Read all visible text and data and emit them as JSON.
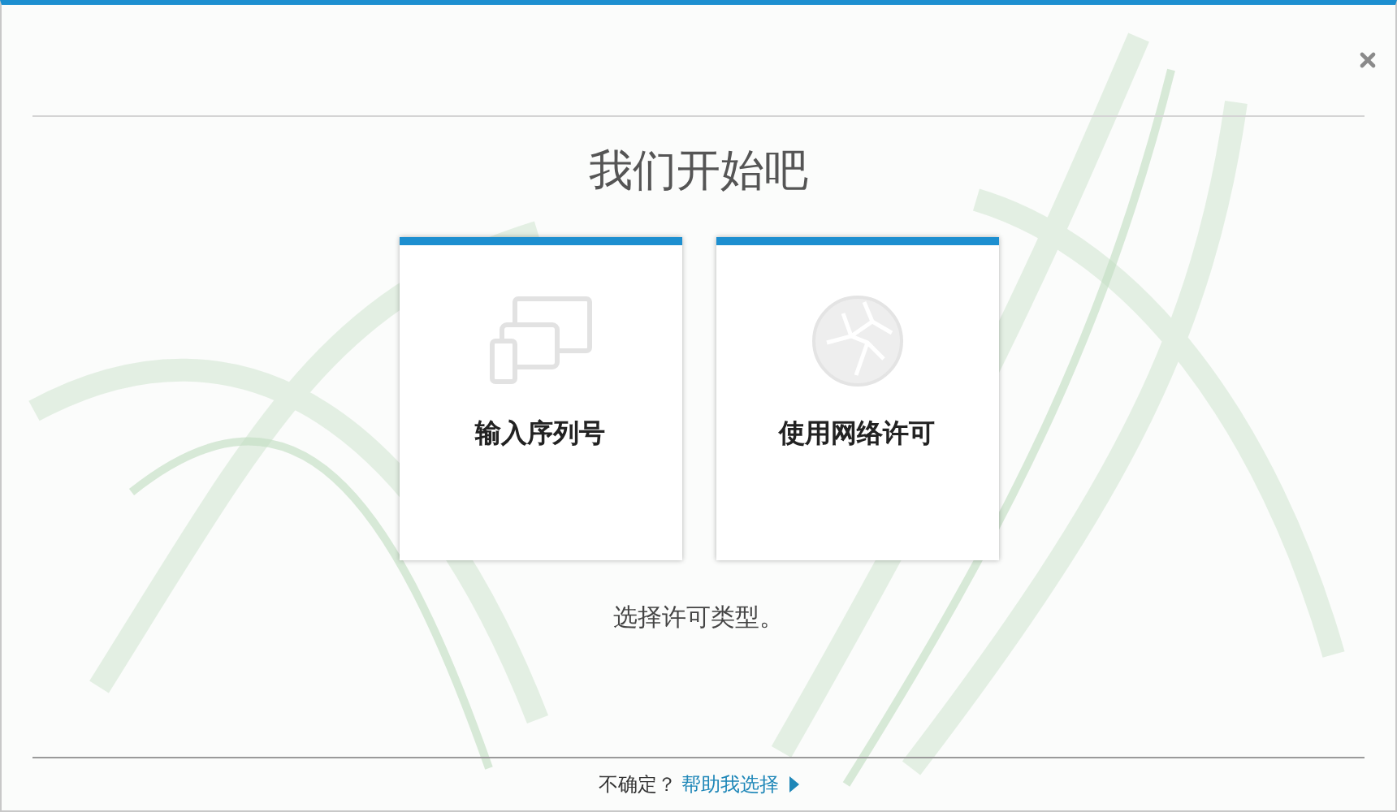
{
  "title": "我们开始吧",
  "options": [
    {
      "kind": "serial",
      "label": "输入序列号"
    },
    {
      "kind": "network",
      "label": "使用网络许可"
    }
  ],
  "instruction": "选择许可类型。",
  "footer": {
    "question": "不确定？",
    "link": "帮助我选择"
  }
}
